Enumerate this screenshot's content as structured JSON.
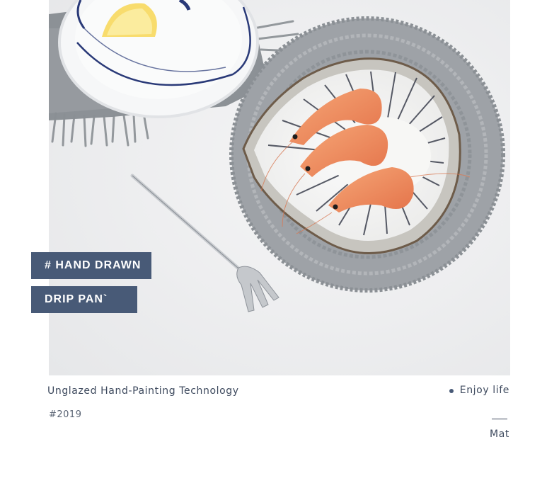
{
  "photo": {
    "icon": "food-photo-image"
  },
  "badges": {
    "line1": "#  HAND DRAWN",
    "line2": "DRIP PAN`"
  },
  "caption": {
    "subtitle": "Unglazed Hand-Painting Technology",
    "year": "#2019",
    "enjoy": "Enjoy life",
    "mat": "Mat"
  },
  "colors": {
    "badge_bg": "#485a77",
    "text": "#3e4a5e",
    "background": "#f0f0f1"
  }
}
